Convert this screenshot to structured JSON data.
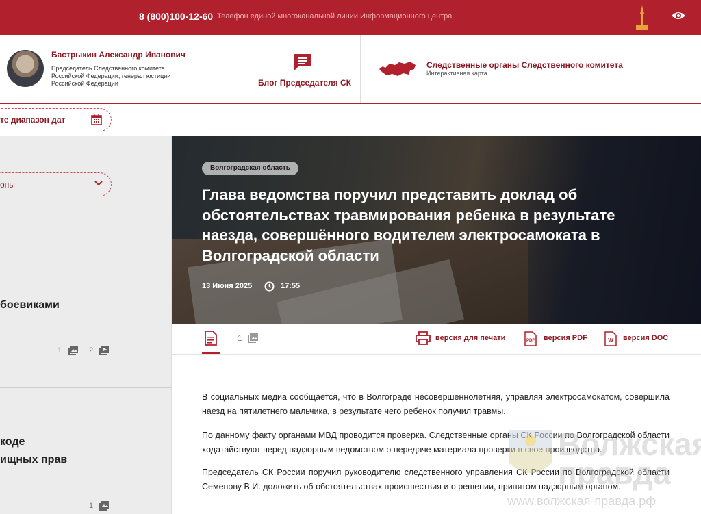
{
  "topbar": {
    "phone": "8 (800)100-12-60",
    "phone_desc": "Телефон единой многоканальной линии Информационного центра"
  },
  "header": {
    "person_name": "Бастрыкин Александр Иванович",
    "person_title": "Председатель Следственного комитета Российской Федерации, генерал юстиции Российской Федерации",
    "blog_label": "Блог Председателя СК",
    "map_title": "Следственные органы Следственного комитета",
    "map_sub": "Интерактивная карта"
  },
  "sidebar": {
    "date_range": "те диапазон дат",
    "region_select": "оны",
    "items": [
      {
        "title": "боевиками",
        "photos": "1",
        "videos": "2"
      },
      {
        "title_line1": "коде",
        "title_line2": "ищных прав",
        "photos": "1"
      }
    ]
  },
  "article": {
    "region_tag": "Волгоградская область",
    "headline": "Глава ведомства поручил представить доклад об обстоятельствах травмирования ребенка в результате наезда, совершённого водителем электросамоката в Волгоградской области",
    "date": "13 Июня 2025",
    "time": "17:55",
    "photo_count": "1",
    "print_label": "версия для печати",
    "pdf_label": "версия PDF",
    "doc_label": "версия DOC",
    "paragraphs": [
      "В социальных медиа сообщается, что в Волгограде несовершеннолетняя, управляя электросамокатом, совершила наезд на пятилетнего мальчика, в результате чего ребенок получил травмы.",
      "По данному факту органами МВД проводится проверка. Следственные органы СК России по Волгоградской области ходатайствуют перед надзорным ведомством о передаче материала проверки в свое производство.",
      "Председатель СК России поручил руководителю следственного управления СК России по Волгоградской области Семенову В.И. доложить об обстоятельствах происшествия и о решении, принятом надзорным органом."
    ]
  },
  "watermark": {
    "text_line1": "Волжская",
    "text_line2": "правда",
    "url": "www.волжская-правда.рф"
  },
  "colors": {
    "brand": "#b0212d",
    "brand_dark": "#8b1a24"
  }
}
